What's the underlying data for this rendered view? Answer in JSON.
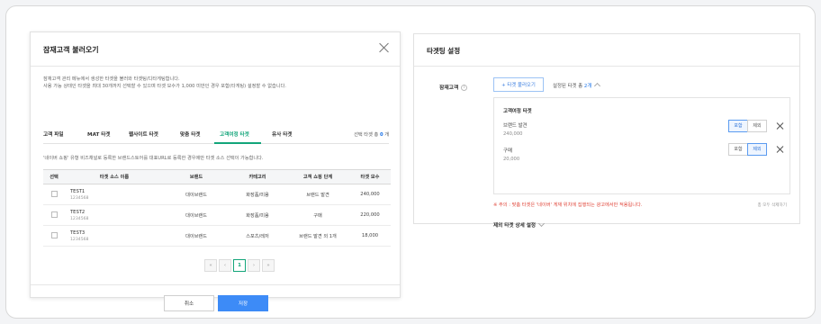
{
  "modal": {
    "title": "잠재고객 불러오기",
    "desc_line1": "잠재고객 관리 메뉴에서 생성한 타겟을 불러와 타겟팅/디타게팅합니다.",
    "desc_line2": "사용 가능 상태인 타겟을 최대 30개까지 선택할 수 있으며 타겟 모수가 1,000 미만인 경우 포함(타게팅) 설정할 수 없습니다.",
    "tabs": [
      {
        "label": "고객 파일"
      },
      {
        "label": "MAT 타겟"
      },
      {
        "label": "웹사이트 타겟"
      },
      {
        "label": "맞춤 타겟"
      },
      {
        "label": "고객여정 타겟"
      },
      {
        "label": "유사 타겟"
      }
    ],
    "active_tab": 4,
    "selected_label": "선택 타겟 총",
    "selected_count": "0",
    "selected_unit": "개",
    "notice": "'네이버 쇼핑' 유형 비즈채널로 등록한 브랜드스토어를 대표URL로 등록한 경우에만 타겟 소스 선택이 가능합니다.",
    "columns": [
      "선택",
      "타겟 소스 이름",
      "브랜드",
      "카테고리",
      "고객 쇼핑 단계",
      "타겟 모수"
    ],
    "rows": [
      {
        "name": "TEST1",
        "id": "1234568",
        "brand": "대이브랜드",
        "category": "화장품/미용",
        "stage": "브랜드 발견",
        "size": "240,000"
      },
      {
        "name": "TEST2",
        "id": "1234568",
        "brand": "대이브랜드",
        "category": "화장품/미용",
        "stage": "구매",
        "size": "220,000"
      },
      {
        "name": "TEST3",
        "id": "1234568",
        "brand": "대이브랜드",
        "category": "스포츠/레저",
        "stage": "브랜드 발견 외 1개",
        "size": "18,000"
      }
    ],
    "pager": {
      "first": "«",
      "prev": "‹",
      "current": "1",
      "next": "›",
      "last": "»"
    },
    "cancel_label": "취소",
    "save_label": "저장"
  },
  "panel": {
    "title": "타겟팅 설정",
    "row_label": "잠재고객",
    "info_glyph": "i",
    "load_button": "+ 타겟 불러오기",
    "set_count_label": "설정된 타겟 총",
    "set_count": "2개",
    "box_title": "고객여정 타겟",
    "items": [
      {
        "name": "브랜드 발견",
        "size": "240,000",
        "include": "포함",
        "exclude": "제외",
        "selected": "include"
      },
      {
        "name": "구매",
        "size": "20,000",
        "include": "포함",
        "exclude": "제외",
        "selected": "exclude"
      }
    ],
    "warning": "※ 주의 : 맞춤 타겟은 '네이버' 게재 위치에 집행되는 광고에서만 적용됩니다.",
    "delete_all": "총 모두 삭제하기",
    "detail_label": "제외 타겟 상세 설정"
  }
}
